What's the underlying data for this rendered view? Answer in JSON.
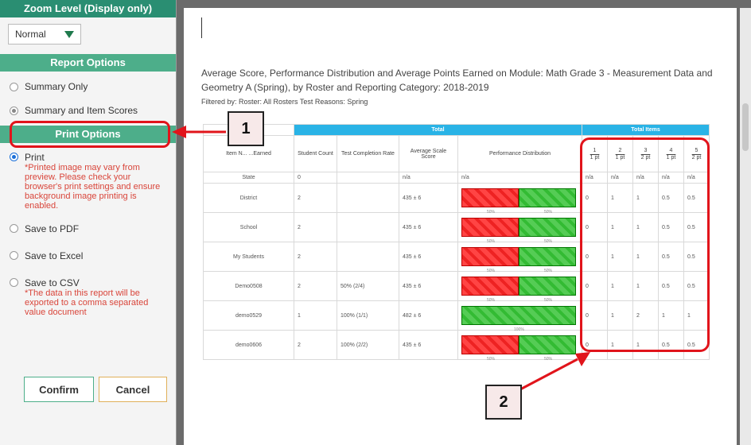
{
  "zoom": {
    "heading": "Zoom Level (Display only)",
    "value": "Normal"
  },
  "report_options": {
    "heading": "Report Options",
    "items": [
      {
        "label": "Summary Only",
        "selected": false
      },
      {
        "label": "Summary and Item Scores",
        "selected": true
      }
    ]
  },
  "print_options": {
    "heading": "Print Options",
    "print_label": "Print",
    "print_note": "*Printed image may vary from preview. Please check your browser's print settings and ensure background image printing is enabled.",
    "pdf_label": "Save to PDF",
    "excel_label": "Save to Excel",
    "csv_label": "Save to CSV",
    "csv_note": "*The data in this report will be exported to a comma separated value document"
  },
  "buttons": {
    "confirm": "Confirm",
    "cancel": "Cancel"
  },
  "report": {
    "title": "Average Score, Performance Distribution and Average Points Earned on Module: Math Grade 3 - Measurement Data and Geometry A (Spring), by Roster and Reporting Category: 2018-2019",
    "filter": "Filtered by: Roster: All Rosters Test Reasons: Spring",
    "band_total": "Total",
    "band_items": "Total Items",
    "headers": [
      "Item N... ...Earned",
      "Student Count",
      "Test Completion Rate",
      "Average Scale Score",
      "Performance Distribution"
    ],
    "item_headers": [
      {
        "num": "1",
        "pts": "1 pt"
      },
      {
        "num": "2",
        "pts": "1 pt"
      },
      {
        "num": "3",
        "pts": "2 pt"
      },
      {
        "num": "4",
        "pts": "1 pt"
      },
      {
        "num": "5",
        "pts": "2 pt"
      }
    ],
    "rows": [
      {
        "name": "State",
        "count": "0",
        "rate": "",
        "score": "n/a",
        "perf": "n/a",
        "red": null,
        "items": [
          "n/a",
          "n/a",
          "n/a",
          "n/a",
          "n/a"
        ]
      },
      {
        "name": "District",
        "count": "2",
        "rate": "",
        "score": "435 ± 6",
        "perf": "",
        "red": 50,
        "lbl_a": "50%",
        "lbl_b": "50%",
        "items": [
          "0",
          "1",
          "1",
          "0.5",
          "0.5"
        ]
      },
      {
        "name": "School",
        "count": "2",
        "rate": "",
        "score": "435 ± 6",
        "perf": "",
        "red": 50,
        "lbl_a": "50%",
        "lbl_b": "50%",
        "items": [
          "0",
          "1",
          "1",
          "0.5",
          "0.5"
        ]
      },
      {
        "name": "My Students",
        "count": "2",
        "rate": "",
        "score": "435 ± 6",
        "perf": "",
        "red": 50,
        "lbl_a": "50%",
        "lbl_b": "50%",
        "items": [
          "0",
          "1",
          "1",
          "0.5",
          "0.5"
        ]
      },
      {
        "name": "Demo0508",
        "count": "2",
        "rate": "50% (2/4)",
        "score": "435 ± 6",
        "perf": "",
        "red": 50,
        "lbl_a": "50%",
        "lbl_b": "50%",
        "items": [
          "0",
          "1",
          "1",
          "0.5",
          "0.5"
        ]
      },
      {
        "name": "demo0529",
        "count": "1",
        "rate": "100% (1/1)",
        "score": "482 ± 6",
        "perf": "",
        "red": 0,
        "lbl_a": "100%",
        "lbl_b": "",
        "items": [
          "0",
          "1",
          "2",
          "1",
          "1"
        ]
      },
      {
        "name": "demo0606",
        "count": "2",
        "rate": "100% (2/2)",
        "score": "435 ± 6",
        "perf": "",
        "red": 50,
        "lbl_a": "50%",
        "lbl_b": "50%",
        "items": [
          "0",
          "1",
          "1",
          "0.5",
          "0.5"
        ]
      }
    ]
  },
  "callouts": {
    "one": "1",
    "two": "2"
  },
  "colors": {
    "green_header": "#4dae8a",
    "highlight": "#e1141b",
    "table_band": "#29b3e6"
  }
}
